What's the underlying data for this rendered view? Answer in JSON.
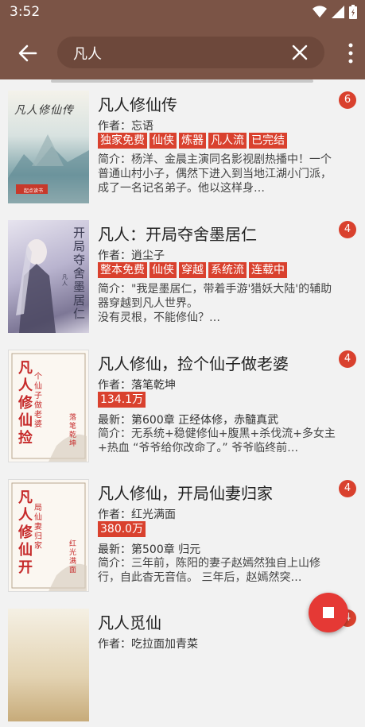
{
  "status": {
    "time": "3:52"
  },
  "search": {
    "query": "凡人"
  },
  "books": [
    {
      "title": "凡人修仙传",
      "count": "6",
      "author": "作者：忘语",
      "tags": [
        "独家免费",
        "仙侠",
        "炼器",
        "凡人流",
        "已完结"
      ],
      "latest": "",
      "desc": "简介：杨洋、金晨主演同名影视剧热播中！一个普通山村小子，偶然下进入到当地江湖小门派，成了一名记名弟子。他以这样身…"
    },
    {
      "title": "凡人：开局夺舍墨居仁",
      "count": "4",
      "author": "作者：逍尘子",
      "tags": [
        "整本免费",
        "仙侠",
        "穿越",
        "系统流",
        "连载中"
      ],
      "latest": "",
      "desc": "简介：\"我是墨居仁，带着手游'猎妖大陆'的辅助器穿越到凡人世界。\n没有灵根，不能修仙？…"
    },
    {
      "title": "凡人修仙，捡个仙子做老婆",
      "count": "4",
      "author": "作者：落笔乾坤",
      "tags": [
        "134.1万"
      ],
      "latest": "最新：第600章 正经体修，赤髓真武",
      "desc": "简介：无系统+稳健修仙+腹黑+杀伐流+多女主+热血 “爷爷给你改命了。” 爷爷临终前…"
    },
    {
      "title": "凡人修仙，开局仙妻归家",
      "count": "4",
      "author": "作者：红光满面",
      "tags": [
        "380.0万"
      ],
      "latest": "最新：第500章 归元",
      "desc": "简介：三年前，陈阳的妻子赵嫣然独自上山修行，自此杳无音信。 三年后，赵嫣然突…"
    },
    {
      "title": "凡人觅仙",
      "count": "4",
      "author": "作者：吃拉面加青菜",
      "tags": [],
      "latest": "",
      "desc": ""
    }
  ],
  "covers": [
    {
      "text": "凡人修仙传",
      "publisher": "起点读书"
    },
    {
      "text": "开局夺舍墨居仁",
      "sub": "凡人"
    },
    {
      "big": "凡人修仙捡",
      "small": "个仙子做老婆",
      "author": "落笔乾坤"
    },
    {
      "big": "凡人修仙开",
      "small": "局仙妻归家",
      "author": "红光满面"
    },
    {}
  ],
  "colors": {
    "appbar": "#7b5446",
    "accent": "#d9412e",
    "fab": "#e53935"
  }
}
